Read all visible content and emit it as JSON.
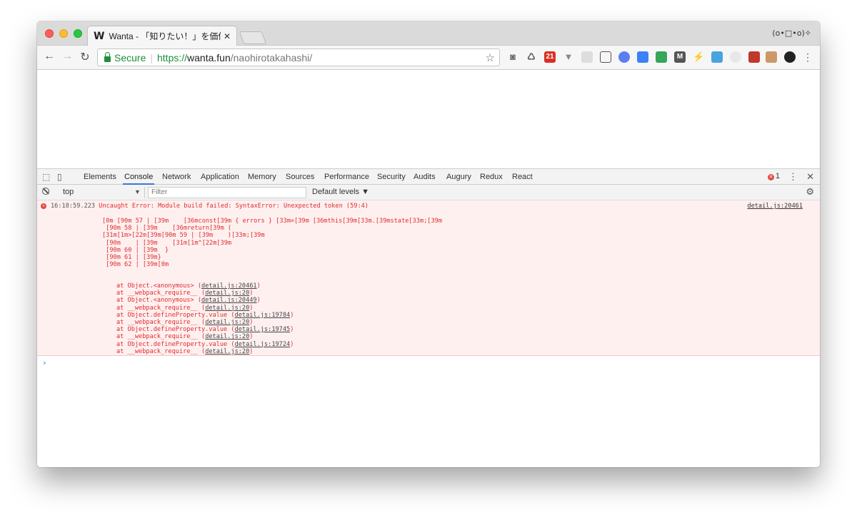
{
  "browser": {
    "tab": {
      "favicon": "W",
      "title": "Wanta - 「知りたい！」を価値に",
      "close": "✕"
    },
    "profile_text": "(o•□•o)✧",
    "address": {
      "secure_label": "Secure",
      "protocol": "https://",
      "host": "wanta.fun",
      "path": "/naohirotakahashi/"
    },
    "extension_icons": [
      "camera-icon",
      "recycle-icon",
      "gmail-icon",
      "vue-icon",
      "cast-icon",
      "screenshot-icon",
      "react-devtools-icon",
      "google-icon",
      "monitor-icon",
      "m-icon",
      "bolt-icon",
      "translate-icon",
      "clock-icon",
      "photo-icon",
      "sheet-icon",
      "github-icon"
    ],
    "gmail_badge": "21",
    "m_label": "M"
  },
  "devtools": {
    "tabs": [
      "Elements",
      "Console",
      "Network",
      "Application",
      "Memory",
      "Sources",
      "Performance",
      "Security",
      "Audits",
      "Augury",
      "Redux",
      "React"
    ],
    "active_tab": "Console",
    "error_count": "1",
    "context": "top",
    "filter_placeholder": "Filter",
    "levels": "Default levels ▼"
  },
  "console": {
    "timestamp": "16:18:59.223",
    "message": "Uncaught Error: Module build failed: SyntaxError: Unexpected token (59:4)",
    "source": "detail.js:20461",
    "body": [
      "[0m [90m 57 | [39m    [36mconst[39m { errors } [33m=[39m [36mthis[39m[33m.[39mstate[33m;[39m",
      " [90m 58 | [39m    [36mreturn[39m (",
      "[31m[1m>[22m[39m[90m 59 | [39m    )[33m;[39m",
      " [90m    | [39m    [31m[1m^[22m[39m",
      " [90m 60 | [39m  }",
      " [90m 61 | [39m}",
      " [90m 62 | [39m[0m"
    ],
    "stack": [
      {
        "pre": "at Object.<anonymous> (",
        "link": "detail.js:20461",
        "post": ")"
      },
      {
        "pre": "at __webpack_require__ (",
        "link": "detail.js:20",
        "post": ")"
      },
      {
        "pre": "at Object.<anonymous> (",
        "link": "detail.js:20449",
        "post": ")"
      },
      {
        "pre": "at __webpack_require__ (",
        "link": "detail.js:20",
        "post": ")"
      },
      {
        "pre": "at Object.defineProperty.value (",
        "link": "detail.js:19784",
        "post": ")"
      },
      {
        "pre": "at __webpack_require__ (",
        "link": "detail.js:20",
        "post": ")"
      },
      {
        "pre": "at Object.defineProperty.value (",
        "link": "detail.js:19745",
        "post": ")"
      },
      {
        "pre": "at __webpack_require__ (",
        "link": "detail.js:20",
        "post": ")"
      },
      {
        "pre": "at Object.defineProperty.value (",
        "link": "detail.js:19724",
        "post": ")"
      },
      {
        "pre": "at __webpack_require__ (",
        "link": "detail.js:20",
        "post": ")"
      }
    ],
    "prompt": "›"
  },
  "colors": {
    "error_text": "#e02c2c",
    "error_bg": "#fff0f0",
    "secure_green": "#1e8e3e",
    "active_tab_underline": "#3879d9"
  }
}
